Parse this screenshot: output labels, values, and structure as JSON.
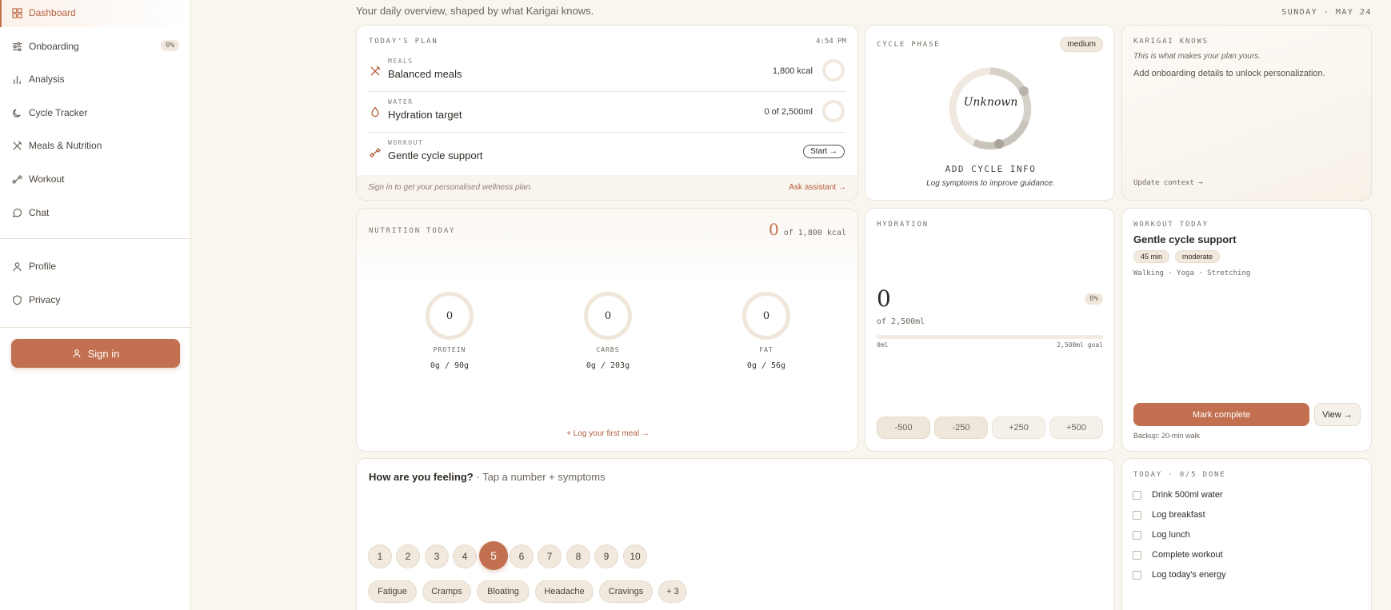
{
  "sidebar": {
    "items": [
      {
        "label": "Dashboard",
        "icon": "grid-icon"
      },
      {
        "label": "Onboarding",
        "icon": "sliders-icon",
        "badge": "0%"
      },
      {
        "label": "Analysis",
        "icon": "bar-chart-icon"
      },
      {
        "label": "Cycle Tracker",
        "icon": "moon-icon"
      },
      {
        "label": "Meals & Nutrition",
        "icon": "utensils-icon"
      },
      {
        "label": "Workout",
        "icon": "dumbbell-icon"
      },
      {
        "label": "Chat",
        "icon": "chat-bubble-icon"
      },
      {
        "label": "Profile",
        "icon": "user-icon"
      },
      {
        "label": "Privacy",
        "icon": "shield-icon"
      }
    ],
    "signin_label": "Sign in"
  },
  "header": {
    "subtitle": "Your daily overview, shaped by what Karigai knows.",
    "date": "SUNDAY · MAY 24"
  },
  "plan": {
    "caption": "TODAY'S PLAN",
    "time": "4:54 PM",
    "rows": [
      {
        "caption": "MEALS",
        "title": "Balanced meals",
        "value": "1,800 kcal"
      },
      {
        "caption": "WATER",
        "title": "Hydration target",
        "value": "0 of 2,500ml"
      },
      {
        "caption": "WORKOUT",
        "title": "Gentle cycle support",
        "action": "Start →"
      }
    ],
    "footer_note": "Sign in to get your personalised wellness plan.",
    "footer_link": "Ask assistant →"
  },
  "cycle": {
    "caption": "CYCLE PHASE",
    "badge": "medium",
    "phase": "Unknown",
    "cta": "ADD CYCLE INFO",
    "note": "Log symptoms to improve guidance."
  },
  "knows": {
    "caption": "KARIGAI KNOWS",
    "tagline": "This is what makes your plan yours.",
    "body": "Add onboarding details to unlock personalization.",
    "link": "Update context →"
  },
  "nutrition": {
    "caption": "NUTRITION TODAY",
    "consumed": "0",
    "target": "of 1,800 kcal",
    "macros": [
      {
        "name": "PROTEIN",
        "value": "0",
        "detail": "0g / 90g"
      },
      {
        "name": "CARBS",
        "value": "0",
        "detail": "0g / 203g"
      },
      {
        "name": "FAT",
        "value": "0",
        "detail": "0g / 56g"
      }
    ],
    "link": "+ Log your first meal →"
  },
  "hydration": {
    "caption": "HYDRATION",
    "amount": "0",
    "of": "of 2,500ml",
    "percent": "0%",
    "progress": 0,
    "scale_min": "0ml",
    "scale_max": "2,500ml goal",
    "buttons": [
      "-500",
      "-250",
      "+250",
      "+500"
    ]
  },
  "workout": {
    "caption": "WORKOUT TODAY",
    "title": "Gentle cycle support",
    "tags": [
      "45 min",
      "moderate"
    ],
    "activities": "Walking · Yoga · Stretching",
    "complete_label": "Mark complete",
    "view_label": "View →",
    "backup": "Backup: 20-min walk"
  },
  "feeling": {
    "question": "How are you feeling?",
    "hint": " · Tap a number + symptoms",
    "scale": [
      "1",
      "2",
      "3",
      "4",
      "5",
      "6",
      "7",
      "8",
      "9",
      "10"
    ],
    "selected": "5",
    "symptoms": [
      "Fatigue",
      "Cramps",
      "Bloating",
      "Headache",
      "Cravings",
      "+ 3"
    ]
  },
  "today": {
    "caption": "TODAY · 0/5 DONE",
    "tasks": [
      "Drink 500ml water",
      "Log breakfast",
      "Log lunch",
      "Complete workout",
      "Log today's energy"
    ]
  },
  "colors": {
    "accent": "#c2704f",
    "background": "#f9f5ef",
    "card": "#ffffff",
    "border": "#ebe3d8"
  }
}
